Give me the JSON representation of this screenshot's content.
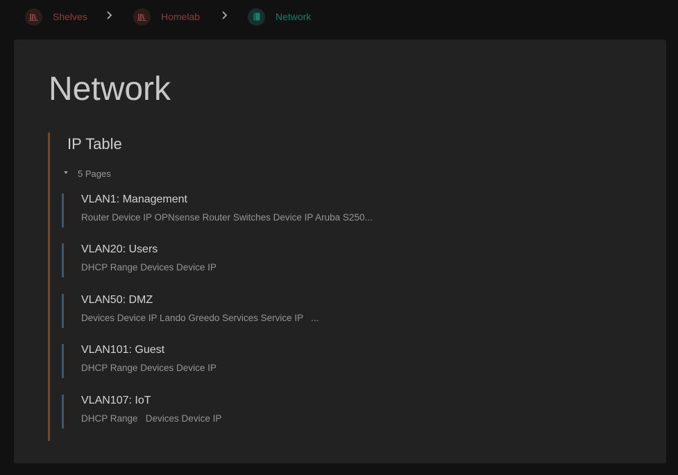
{
  "breadcrumbs": [
    {
      "label": "Shelves",
      "type": "shelves"
    },
    {
      "label": "Homelab",
      "type": "shelf"
    },
    {
      "label": "Network",
      "type": "book"
    }
  ],
  "colors": {
    "shelf_accent": "#8a3f3a",
    "book_accent": "#1f7a6a",
    "chapter_accent": "#7b4420",
    "page_accent": "#2f5a86"
  },
  "page": {
    "title": "Network"
  },
  "chapter": {
    "title": "IP Table",
    "pages_count_label": "5 Pages",
    "pages": [
      {
        "title": "VLAN1: Management",
        "excerpt": "Router Device IP OPNsense Router Switches Device IP Aruba S250..."
      },
      {
        "title": "VLAN20: Users",
        "excerpt": "DHCP Range Devices Device IP"
      },
      {
        "title": "VLAN50: DMZ",
        "excerpt": "Devices Device IP Lando Greedo Services Service IP   ..."
      },
      {
        "title": "VLAN101: Guest",
        "excerpt": "DHCP Range Devices Device IP"
      },
      {
        "title": "VLAN107: IoT",
        "excerpt": "DHCP Range   Devices Device IP"
      }
    ]
  }
}
